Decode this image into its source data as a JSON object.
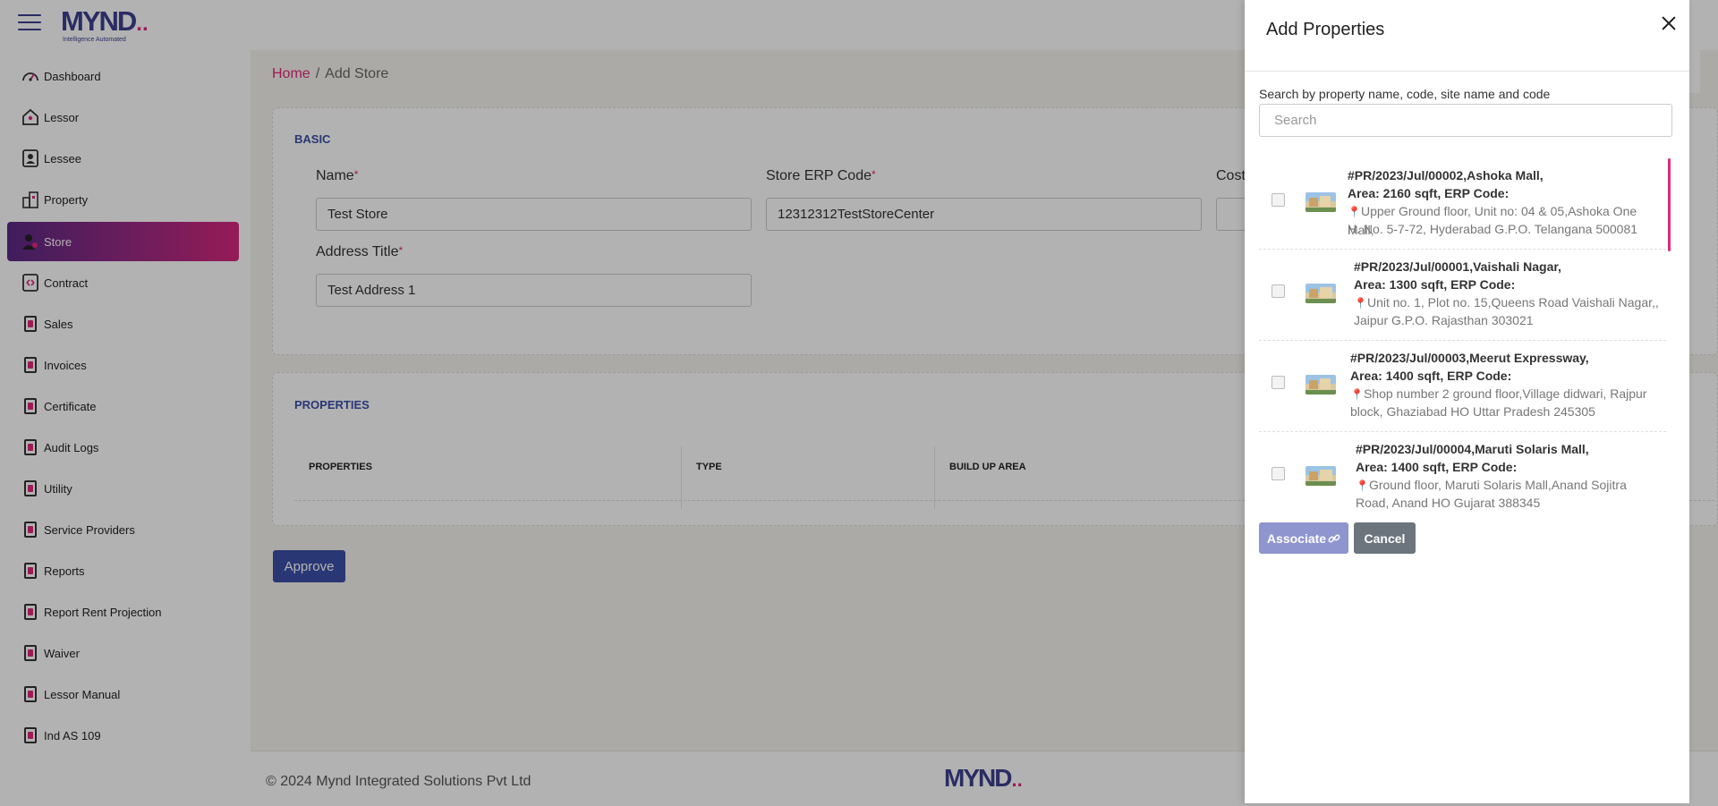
{
  "brand": {
    "name": "MYND",
    "dots": "..",
    "tagline": "Intelligence Automated"
  },
  "sidebar": {
    "items": [
      {
        "label": "Dashboard",
        "icon": "dashboard-icon"
      },
      {
        "label": "Lessor",
        "icon": "lessor-icon"
      },
      {
        "label": "Lessee",
        "icon": "lessee-icon"
      },
      {
        "label": "Property",
        "icon": "property-icon"
      },
      {
        "label": "Store",
        "icon": "store-icon",
        "active": true
      },
      {
        "label": "Contract",
        "icon": "contract-icon"
      },
      {
        "label": "Sales",
        "icon": "book-icon"
      },
      {
        "label": "Invoices",
        "icon": "book-icon"
      },
      {
        "label": "Certificate",
        "icon": "book-icon"
      },
      {
        "label": "Audit Logs",
        "icon": "book-icon"
      },
      {
        "label": "Utility",
        "icon": "book-icon"
      },
      {
        "label": "Service Providers",
        "icon": "book-icon"
      },
      {
        "label": "Reports",
        "icon": "book-icon"
      },
      {
        "label": "Report Rent Projection",
        "icon": "book-icon"
      },
      {
        "label": "Waiver",
        "icon": "book-icon"
      },
      {
        "label": "Lessor Manual",
        "icon": "book-icon"
      },
      {
        "label": "Ind AS 109",
        "icon": "book-icon"
      }
    ]
  },
  "breadcrumb": {
    "home": "Home",
    "separator": "/",
    "current": "Add Store"
  },
  "basic": {
    "title": "BASIC",
    "name_label": "Name",
    "name_value": "Test Store",
    "erp_label": "Store ERP Code",
    "erp_value": "12312312TestStoreCenter",
    "cost_label": "Cost",
    "address_label": "Address Title",
    "address_value": "Test Address 1",
    "required_mark": "*"
  },
  "properties_card": {
    "title": "PROPERTIES",
    "columns": [
      "PROPERTIES",
      "TYPE",
      "BUILD UP AREA"
    ]
  },
  "actions": {
    "approve": "Approve"
  },
  "footer": {
    "copyright": "© 2024 Mynd Integrated Solutions Pvt Ltd"
  },
  "panel": {
    "title": "Add Properties",
    "search_label": "Search by property name, code, site name and code",
    "search_placeholder": "Search",
    "associate_label": "Associate",
    "cancel_label": "Cancel",
    "items": [
      {
        "line1": "#PR/2023/Jul/00002,Ashoka Mall,",
        "line2": "Area: 2160 sqft, ERP Code:",
        "addr1": "Upper Ground floor, Unit no: 04 & 05,Ashoka One Mall,",
        "addr2": "H. No. 5-7-72, Hyderabad G.P.O. Telangana 500081"
      },
      {
        "line1": "#PR/2023/Jul/00001,Vaishali Nagar,",
        "line2": "Area: 1300 sqft, ERP Code:",
        "addr1": "Unit no. 1, Plot no. 15,Queens Road Vaishali Nagar,,",
        "addr2": "Jaipur G.P.O. Rajasthan 303021"
      },
      {
        "line1": "#PR/2023/Jul/00003,Meerut Expressway,",
        "line2": "Area: 1400 sqft, ERP Code:",
        "addr1": "Shop number 2 ground floor,Village didwari, Rajpur",
        "addr2": "block, Ghaziabad HO Uttar Pradesh 245305"
      },
      {
        "line1": "#PR/2023/Jul/00004,Maruti Solaris Mall,",
        "line2": "Area: 1400 sqft, ERP Code:",
        "addr1": "Ground floor, Maruti Solaris Mall,Anand Sojitra",
        "addr2": "Road, Anand HO Gujarat 388345"
      }
    ]
  },
  "colors": {
    "accent": "#e0287d",
    "primary": "#3d4fa8",
    "brand": "#3d3f8f"
  }
}
